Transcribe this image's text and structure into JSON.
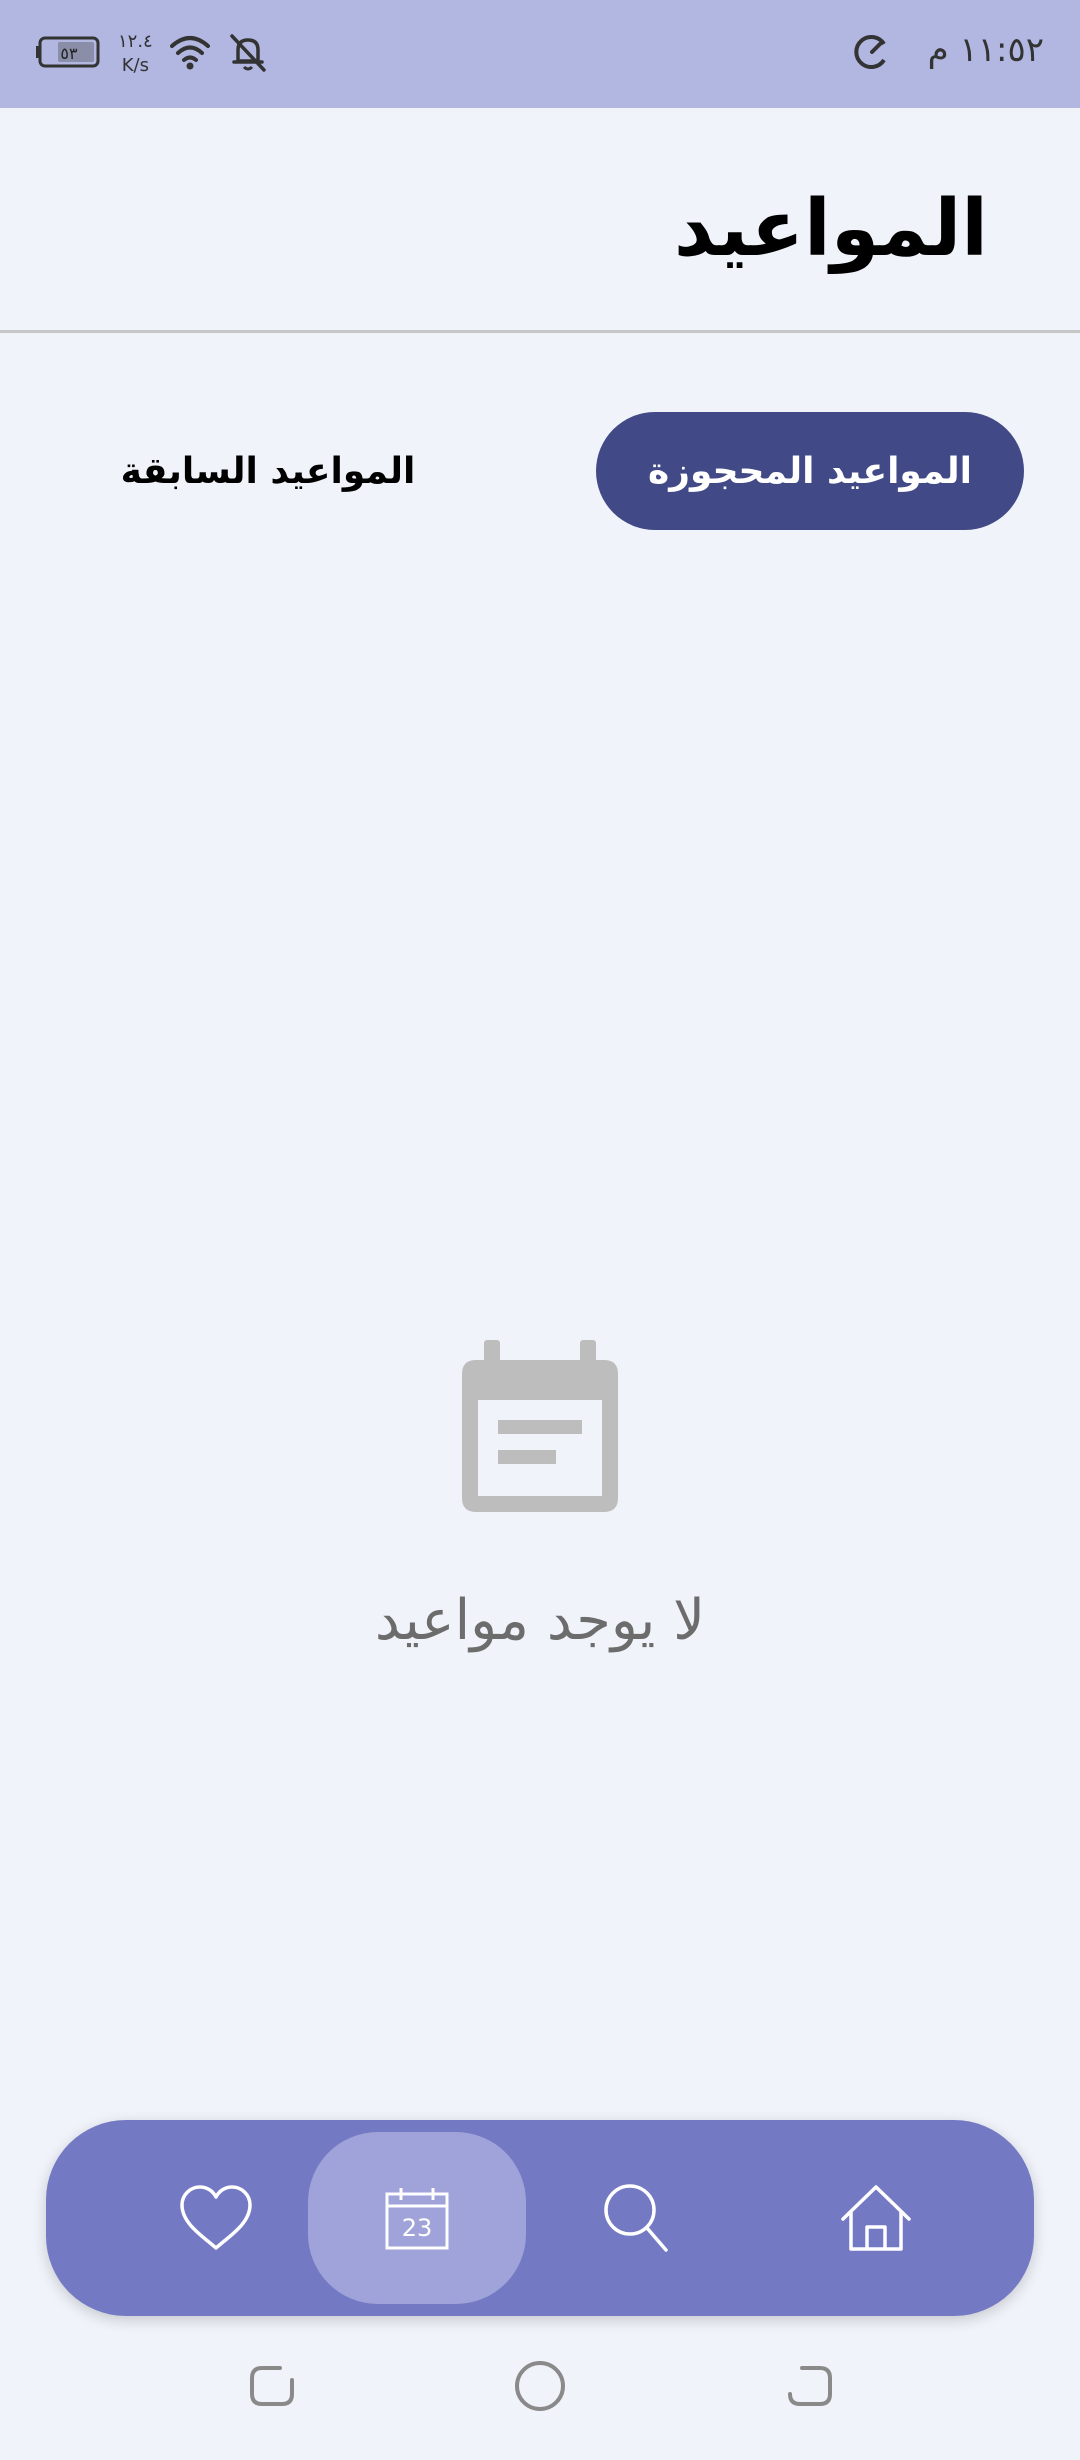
{
  "status_bar": {
    "time": "١١:٥٢ م",
    "battery": "٥٣",
    "speed_value": "١٢.٤",
    "speed_unit": "K/s"
  },
  "header": {
    "title": "المواعيد"
  },
  "tabs": [
    {
      "label": "المواعيد المحجوزة",
      "active": true
    },
    {
      "label": "المواعيد السابقة",
      "active": false
    }
  ],
  "empty_state": {
    "icon": "calendar-icon",
    "message": "لا يوجد مواعيد"
  },
  "bottom_nav": {
    "items": [
      {
        "icon": "heart-icon"
      },
      {
        "icon": "calendar-icon",
        "date": "23",
        "active": true
      },
      {
        "icon": "search-icon"
      },
      {
        "icon": "home-icon"
      }
    ]
  },
  "colors": {
    "status_bar": "#b1b7e0",
    "background": "#f0f4fa",
    "tab_active": "#414986",
    "nav_bar": "#7379c3",
    "nav_active": "#9fa3d9"
  }
}
